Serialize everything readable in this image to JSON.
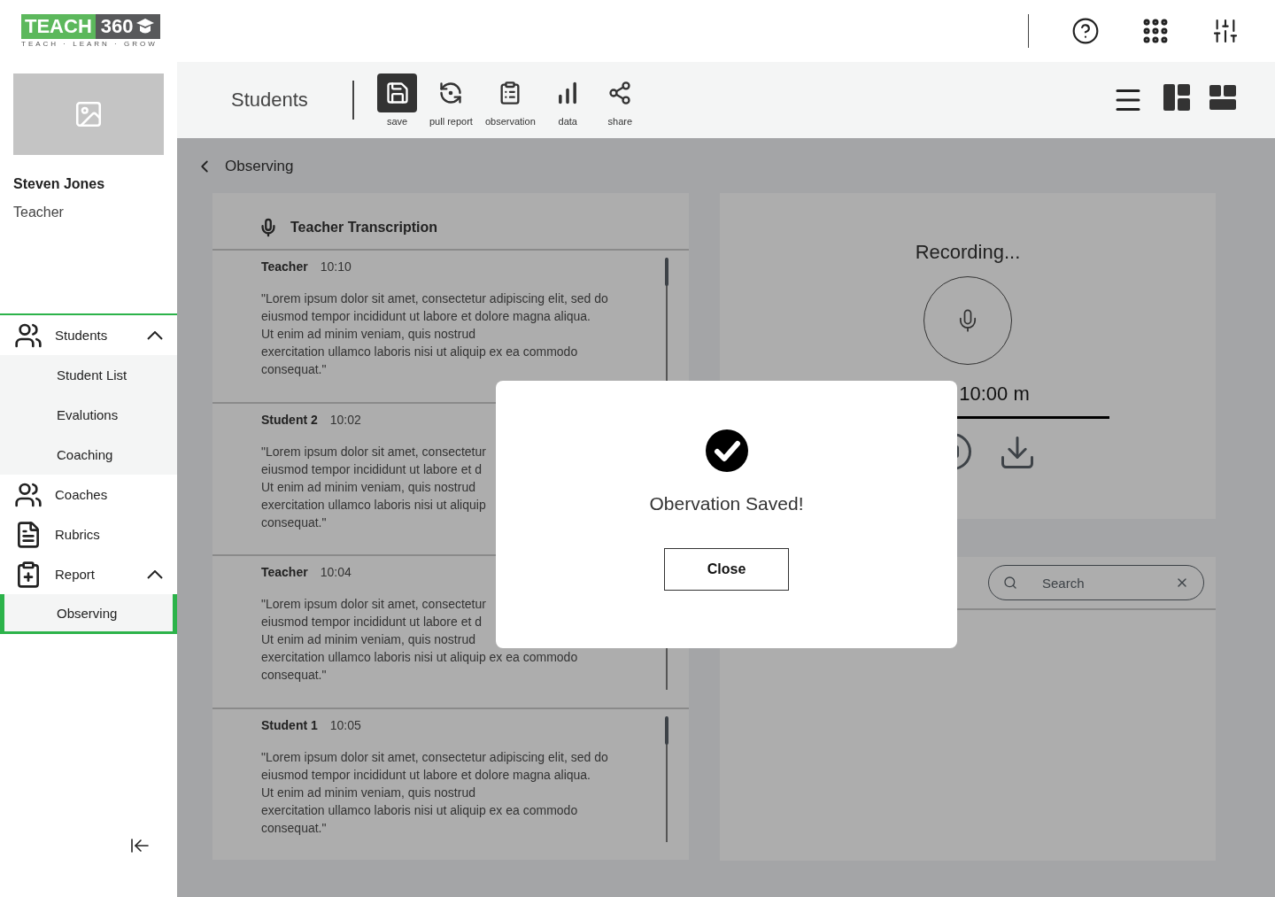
{
  "header": {
    "logo": {
      "word_1": "TEACH",
      "word_2": "360",
      "tagline": "TEACH · LEARN · GROW"
    }
  },
  "profile": {
    "name": "Steven Jones",
    "role": "Teacher"
  },
  "nav": [
    {
      "label": "Students",
      "kind": "people",
      "expanded": true,
      "children": [
        {
          "label": "Student List",
          "selected": false
        },
        {
          "label": "Evalutions",
          "selected": false
        },
        {
          "label": "Coaching",
          "selected": false
        }
      ]
    },
    {
      "label": "Coaches",
      "kind": "people"
    },
    {
      "label": "Rubrics",
      "kind": "rubric"
    },
    {
      "label": "Report",
      "kind": "report",
      "expanded": true,
      "children": [
        {
          "label": "Observing",
          "selected": true
        }
      ]
    }
  ],
  "toolbar": {
    "title": "Students",
    "tools": [
      {
        "label": "save",
        "kind": "save",
        "selected": true
      },
      {
        "label": "pull report",
        "kind": "pull",
        "selected": false
      },
      {
        "label": "observation",
        "kind": "clipboard",
        "selected": false
      },
      {
        "label": "data",
        "kind": "chart",
        "selected": false
      },
      {
        "label": "share",
        "kind": "share",
        "selected": false
      }
    ]
  },
  "breadcrumb": "Observing",
  "transcription": {
    "title": "Teacher Transcription",
    "entries": [
      {
        "speaker": "Teacher",
        "time": "10:10",
        "lines": [
          "\"Lorem ipsum dolor sit amet, consectetur adipiscing elit, sed do",
          "eiusmod tempor incididunt ut labore et dolore magna aliqua.",
          "Ut enim ad minim veniam, quis nostrud",
          "exercitation ullamco laboris nisi ut aliquip ex ea commodo",
          "consequat.\""
        ]
      },
      {
        "speaker": "Student 2",
        "time": "10:02",
        "lines": [
          "\"Lorem ipsum dolor sit amet, consectetur",
          "eiusmod tempor incididunt ut labore et d",
          "Ut enim ad minim veniam, quis nostrud",
          "exercitation ullamco laboris nisi ut aliquip",
          "consequat.\""
        ]
      },
      {
        "speaker": "Teacher",
        "time": "10:04",
        "lines": [
          "\"Lorem ipsum dolor sit amet, consectetur",
          "eiusmod tempor incididunt ut labore et d",
          "Ut enim ad minim veniam, quis nostrud",
          "exercitation ullamco laboris nisi ut aliquip ex ea commodo",
          "consequat.\""
        ]
      },
      {
        "speaker": "Student 1",
        "time": "10:05",
        "lines": [
          "\"Lorem ipsum dolor sit amet, consectetur adipiscing elit, sed do",
          "eiusmod tempor incididunt ut labore et dolore magna aliqua.",
          "Ut enim ad minim veniam, quis nostrud",
          "exercitation ullamco laboris nisi ut aliquip ex ea commodo",
          "consequat.\""
        ]
      }
    ]
  },
  "recorder": {
    "status": "Recording...",
    "time": "10:00 m"
  },
  "search": {
    "placeholder": "Search"
  },
  "modal": {
    "message": "Obervation Saved!",
    "button": "Close"
  }
}
